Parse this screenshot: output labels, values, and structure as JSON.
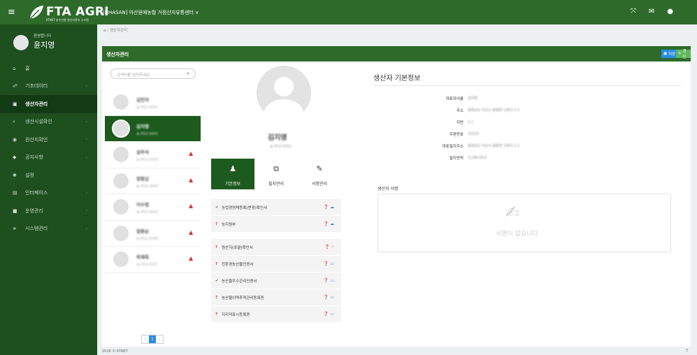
{
  "topbar": {
    "logo_text": "FTA AGRI",
    "logo_sub": "KTNET 농수산물 원산지관리 시스템",
    "org": "[NHASAN] 아산원예농협 거점산지유통센터 ∨",
    "colors": {
      "green": "#2e6b2b",
      "sidebar": "#1d4f1f"
    }
  },
  "profile": {
    "welcome": "환영합니다",
    "name": "윤지영"
  },
  "menu": [
    {
      "label": "홈",
      "icon": "home-icon"
    },
    {
      "label": "기초데이터",
      "icon": "users-icon"
    },
    {
      "label": "생산자관리",
      "icon": "user-card-icon"
    },
    {
      "label": "생산시설확인",
      "icon": "search-icon"
    },
    {
      "label": "원산지확인",
      "icon": "check-circle-icon"
    },
    {
      "label": "공지사항",
      "icon": "chat-icon"
    },
    {
      "label": "설정",
      "icon": "gear-icon"
    },
    {
      "label": "인터페이스",
      "icon": "database-icon"
    },
    {
      "label": "운영관리",
      "icon": "grid-icon"
    },
    {
      "label": "시스템관리",
      "icon": "sliders-icon"
    }
  ],
  "panel": {
    "title": "생산자관리",
    "save": "저장",
    "update": "갱신",
    "search_placeholder": "검색어를 입력하세요"
  },
  "producers": [
    {
      "name": "김민자",
      "code": "농-PO2-0001",
      "warn": false
    },
    {
      "name": "김지영",
      "code": "농-PO2-0002",
      "warn": false
    },
    {
      "name": "성주석",
      "code": "농-PO2-0003",
      "warn": true
    },
    {
      "name": "양용남",
      "code": "농-PO2-0004",
      "warn": true
    },
    {
      "name": "이수영",
      "code": "농-PO2-0005",
      "warn": true
    },
    {
      "name": "임동순",
      "code": "농-PO2-0006",
      "warn": true
    },
    {
      "name": "최재옥",
      "code": "농-PO2-0007",
      "warn": true
    }
  ],
  "pager": {
    "prev": "‹",
    "page": "1",
    "next": "›"
  },
  "selected": {
    "name": "김지영",
    "code": "농-PO2-0002"
  },
  "tabs": [
    {
      "label": "기본정보",
      "icon": "user-icon"
    },
    {
      "label": "필지관리",
      "icon": "map-icon"
    },
    {
      "label": "서명관리",
      "icon": "pen-icon"
    }
  ],
  "docs": [
    {
      "status": "✔",
      "label": "농업경영체등록(변경)확인서",
      "act2": "☁"
    },
    {
      "status": "?",
      "label": "농지원부",
      "act2": "☁"
    },
    {
      "status": "?",
      "label": "원산지(포괄)확인서",
      "act2": "⚡"
    },
    {
      "status": "?",
      "label": "친환경농산물인증서",
      "act2": "▭"
    },
    {
      "status": "✔",
      "label": "농산물우수관리인증서",
      "act2": "▭"
    },
    {
      "status": "?",
      "label": "농산물이력추적관리등록증",
      "act2": "▭"
    },
    {
      "status": "?",
      "label": "지리적표시등록증",
      "act2": "▭"
    }
  ],
  "info": {
    "title": "생산자 기본정보",
    "rows": [
      {
        "k": "대표자이름",
        "v": "김지영"
      },
      {
        "k": "주소",
        "v": "충청남도 아산시 음봉면 신휴리 1-1"
      },
      {
        "k": "지번",
        "v": "1-1"
      },
      {
        "k": "우편번호",
        "v": "31524"
      },
      {
        "k": "대표필지주소",
        "v": "충청남도 아산시 음봉면 신휴리 1-1"
      },
      {
        "k": "필지면적",
        "v": "3,348.00㎡"
      }
    ],
    "sig_label": "생산자 서명",
    "sig_empty": "서명이 없습니다"
  },
  "breadcrumb": {
    "home": "⌂",
    "current": "생산자관리"
  },
  "footer": "2018 © KTNET"
}
